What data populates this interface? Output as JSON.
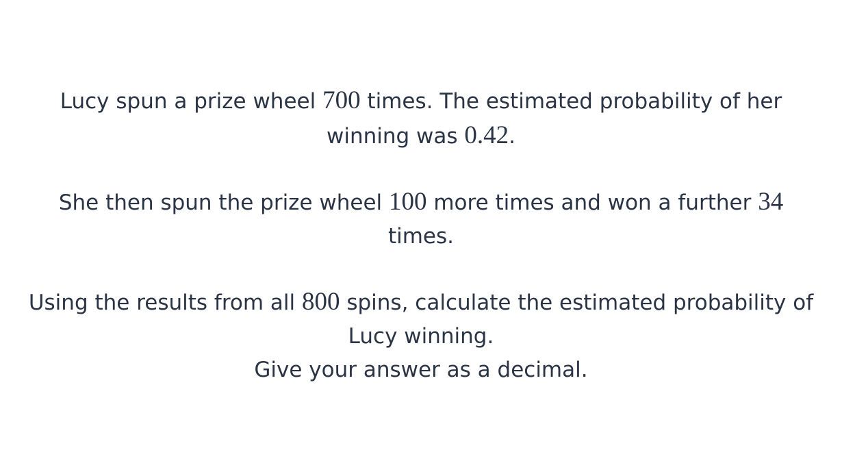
{
  "question": {
    "p1": {
      "t1": "Lucy spun a prize wheel ",
      "n1": "700",
      "t2": " times. The estimated probability of her winning was ",
      "n2": "0.42",
      "t3": "."
    },
    "p2": {
      "t1": "She then spun the prize wheel ",
      "n1": "100",
      "t2": " more times and won a further ",
      "n2": "34",
      "t3": " times."
    },
    "p3": {
      "t1": "Using the results from all ",
      "n1": "800",
      "t2": " spins, calculate the estimated probability of Lucy winning.",
      "line2": "Give your answer as a decimal."
    }
  }
}
